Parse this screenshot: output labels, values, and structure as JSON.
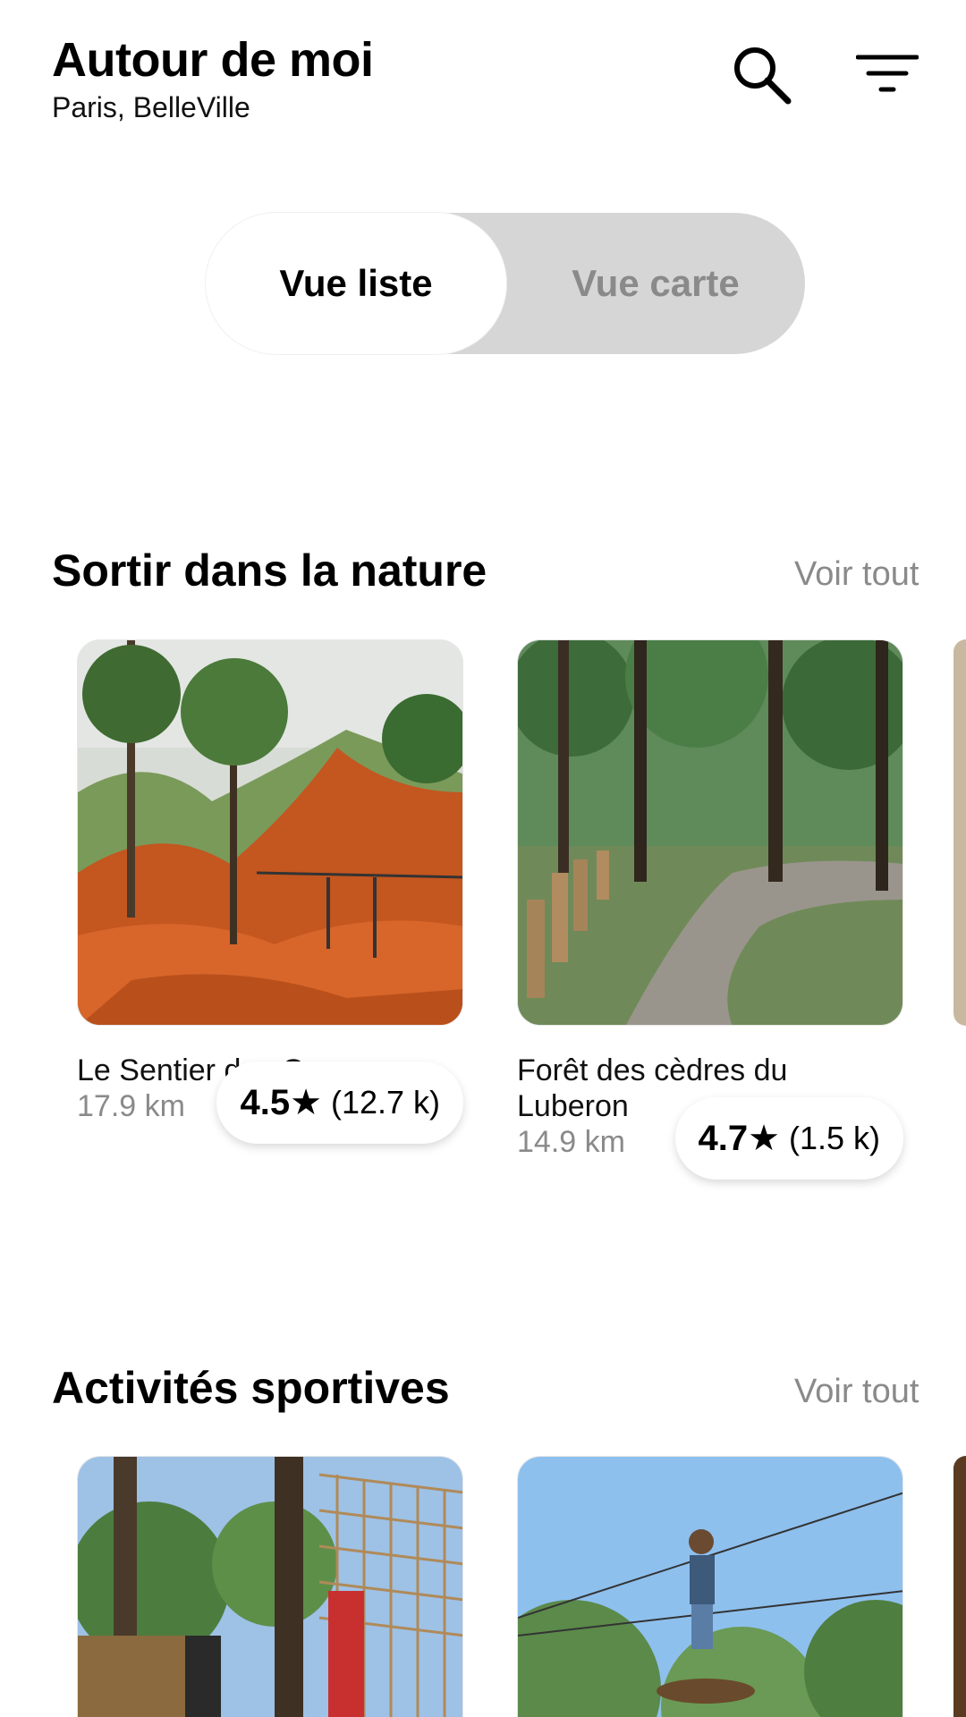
{
  "header": {
    "title": "Autour de moi",
    "subtitle": "Paris, BelleVille",
    "search_icon": "search-icon",
    "filter_icon": "filter-icon"
  },
  "view_toggle": {
    "list_label": "Vue liste",
    "map_label": "Vue carte",
    "selected": "list"
  },
  "sections": [
    {
      "title": "Sortir dans la nature",
      "see_all": "Voir tout",
      "cards": [
        {
          "name": "Le Sentier des Ocres",
          "distance": "17.9 km",
          "rating": "4.5",
          "star": "★",
          "reviews": "(12.7 k)"
        },
        {
          "name": "Forêt des cèdres du Luberon",
          "distance": "14.9 km",
          "rating": "4.7",
          "star": "★",
          "reviews": "(1.5 k)"
        }
      ]
    },
    {
      "title": "Activités sportives",
      "see_all": "Voir tout"
    }
  ],
  "colors": {
    "muted_text": "#8a8a8a",
    "toggle_bg": "#d6d6d6"
  }
}
